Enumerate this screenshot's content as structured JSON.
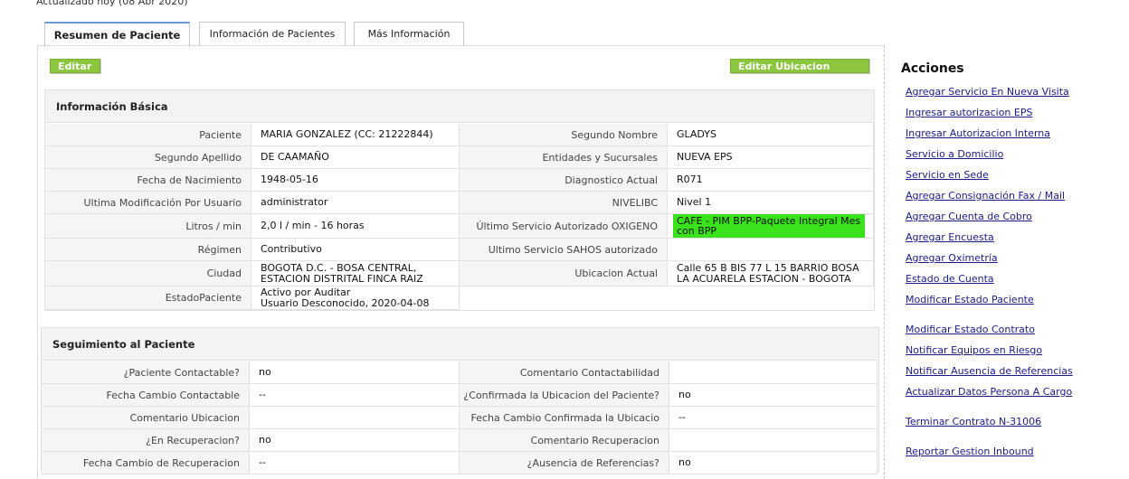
{
  "top_note": "Actualizado hoy (08 Abr 2020)",
  "tabs": [
    "Resumen de Paciente",
    "Información de Pacientes",
    "Más Información"
  ],
  "buttons": {
    "edit": "Editar",
    "edit_location": "Editar Ubicacion principal"
  },
  "basic_info": {
    "title": "Información Básica",
    "rows": [
      {
        "l1": "Paciente",
        "v1": "MARIA GONZALEZ (CC: 21222844)",
        "l2": "Segundo Nombre",
        "v2": " GLADYS"
      },
      {
        "l1": "Segundo Apellido",
        "v1": " DE CAAMAÑO",
        "l2": "Entidades y Sucursales",
        "v2": "NUEVA EPS"
      },
      {
        "l1": "Fecha de Nacimiento",
        "v1": "1948-05-16",
        "l2": "Diagnostico Actual",
        "v2": "R071"
      },
      {
        "l1": "Ultima Modificación Por Usuario",
        "v1": " administrator",
        "l2": "NIVELIBC",
        "v2": " Nivel 1"
      },
      {
        "l1": "Litros / min",
        "v1": " 2,0 l / min - 16 horas",
        "l2": "Último Servicio Autorizado OXIGENO",
        "v2": "CAFE - PIM BPP-Paquete Integral Mes con BPP"
      },
      {
        "l1": "Régimen",
        "v1": " Contributivo",
        "l2": "Ultimo Servicio SAHOS autorizado",
        "v2": ""
      },
      {
        "l1": "Ciudad",
        "v1": " BOGOTA D.C. - BOSA CENTRAL, ESTACION DISTRITAL FINCA RAIZ",
        "l2": "Ubicacion Actual",
        "v2": "Calle 65 B BIS 77 L 15 BARRIO BOSA LA ACUARELA ESTACION - BOGOTA"
      },
      {
        "l1": "EstadoPaciente",
        "v1": " Activo por Auditar\n Usuario Desconocido, 2020-04-08"
      }
    ]
  },
  "followup": {
    "title": "Seguimiento al Paciente",
    "rows": [
      {
        "l1": "¿Paciente Contactable?",
        "v1": "no",
        "l2": "Comentario Contactabilidad",
        "v2": ""
      },
      {
        "l1": "Fecha Cambio Contactable",
        "v1": "--",
        "l2": "¿Confirmada la Ubicacion del Paciente?",
        "v2": "no"
      },
      {
        "l1": "Comentario Ubicacion",
        "v1": "",
        "l2": "Fecha Cambio Confirmada la Ubicacio",
        "v2": "--"
      },
      {
        "l1": "¿En Recuperacion?",
        "v1": "no",
        "l2": "Comentario Recuperacion",
        "v2": ""
      },
      {
        "l1": "Fecha Cambio de Recuperacion",
        "v1": "--",
        "l2": "¿Ausencia de Referencias?",
        "v2": "no"
      }
    ]
  },
  "actions": {
    "title": "Acciones",
    "items": [
      "Agregar Servicio En Nueva Visita",
      "Ingresar autorizacion EPS",
      "Ingresar Autorizacion Interna",
      "Servicio a Domicilio",
      "Servicio en Sede",
      "Agregar Consignación Fax / Mail",
      "Agregar Cuenta de Cobro",
      "Agregar Encuesta",
      "Agregar Oximetría",
      "Estado de Cuenta",
      "Modificar Estado Paciente",
      "Modificar Estado Contrato",
      "Notificar Equipos en Riesgo",
      "Notificar Ausencia de Referencias",
      "Actualizar Datos Persona A Cargo",
      "Terminar Contrato N-31006",
      "Reportar Gestion Inbound"
    ]
  }
}
